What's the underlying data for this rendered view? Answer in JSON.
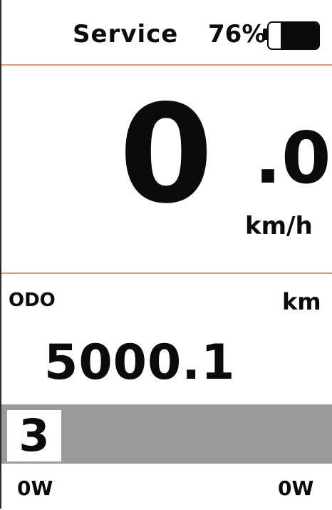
{
  "status": {
    "mode_label": "Service",
    "battery_percent_text": "76%",
    "battery_level": 0.76
  },
  "speed": {
    "integer": "0",
    "decimal": ".0",
    "unit": "km/h"
  },
  "odometer": {
    "label": "ODO",
    "unit": "km",
    "value": "5000.1"
  },
  "assist": {
    "level": "3"
  },
  "power": {
    "left": "0W",
    "right": "0W"
  },
  "colors": {
    "divider": "#e59a6a",
    "assist_bar": "#9a9a9a",
    "text": "#0b0b0b"
  }
}
